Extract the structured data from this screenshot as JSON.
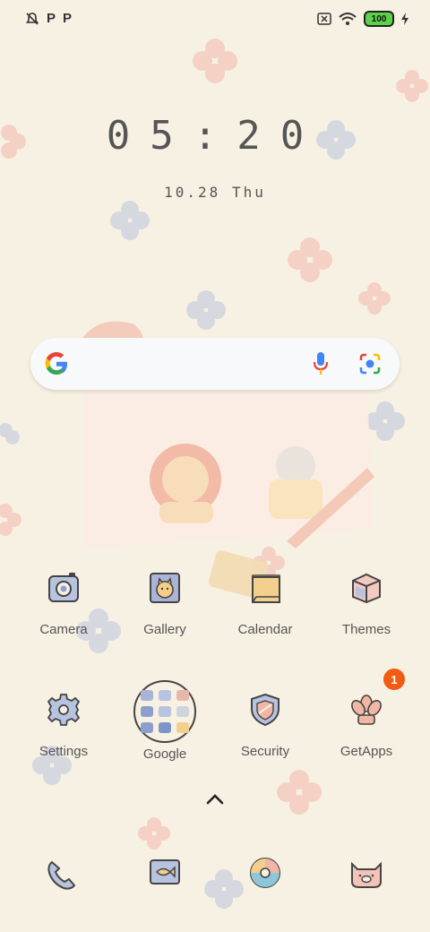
{
  "status_bar": {
    "left_icons": [
      "notifications-off-icon",
      "p-app-icon",
      "p-app-icon"
    ],
    "p_glyph": "P",
    "right_icons": [
      "sim-off-icon",
      "wifi-icon",
      "battery-icon",
      "charging-icon"
    ],
    "battery_level": "100"
  },
  "clock": {
    "time": "05:20",
    "date": "10.28 Thu"
  },
  "search": {
    "logo_icon": "google-g-icon",
    "mic_icon": "mic-icon",
    "lens_icon": "lens-icon"
  },
  "apps_row1": [
    {
      "label": "Camera",
      "icon": "camera-icon"
    },
    {
      "label": "Gallery",
      "icon": "gallery-icon"
    },
    {
      "label": "Calendar",
      "icon": "calendar-icon"
    },
    {
      "label": "Themes",
      "icon": "themes-icon"
    }
  ],
  "apps_row2": [
    {
      "label": "Settings",
      "icon": "settings-icon"
    },
    {
      "label": "Google",
      "icon": "google-folder"
    },
    {
      "label": "Security",
      "icon": "security-icon"
    },
    {
      "label": "GetApps",
      "icon": "getapps-icon",
      "badge": "1"
    }
  ],
  "dock": [
    {
      "icon": "phone-icon"
    },
    {
      "icon": "messages-icon"
    },
    {
      "icon": "browser-icon"
    },
    {
      "icon": "pig-icon"
    }
  ],
  "colors": {
    "background": "#f7f1e3",
    "badge": "#f25b12",
    "battery": "#5ad34a"
  }
}
